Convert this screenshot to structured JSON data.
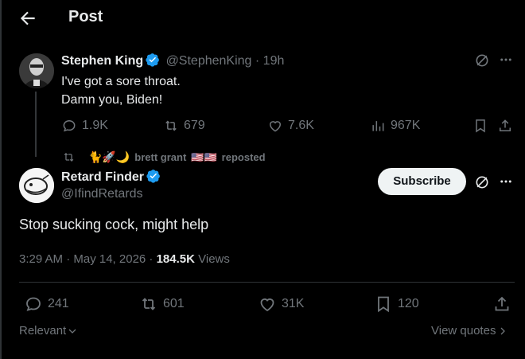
{
  "header": {
    "title": "Post"
  },
  "parent_tweet": {
    "name": "Stephen King",
    "handle": "@StephenKing",
    "time": "· 19h",
    "lines": [
      "I've got a sore throat.",
      "Damn you, Biden!"
    ],
    "stats": {
      "replies": "1.9K",
      "retweets": "679",
      "likes": "7.6K",
      "views": "967K"
    }
  },
  "repost": {
    "emoji": "🐈🚀🌙",
    "name": "brett grant",
    "flags": "🇺🇸🇺🇸",
    "label": "reposted"
  },
  "main_tweet": {
    "name": "Retard Finder",
    "handle": "@IfindRetards",
    "subscribe_label": "Subscribe",
    "text": "Stop sucking cock, might help",
    "timestamp": "3:29 AM · May 14, 2026 ·",
    "views_count": "184.5K",
    "views_label": "Views",
    "stats": {
      "replies": "241",
      "retweets": "601",
      "likes": "31K",
      "bookmarks": "120"
    }
  },
  "footer": {
    "sort_label": "Relevant",
    "quotes_label": "View quotes"
  },
  "colors": {
    "verified": "#1d9bf0",
    "muted": "#71767b",
    "text": "#e7e9ea"
  }
}
